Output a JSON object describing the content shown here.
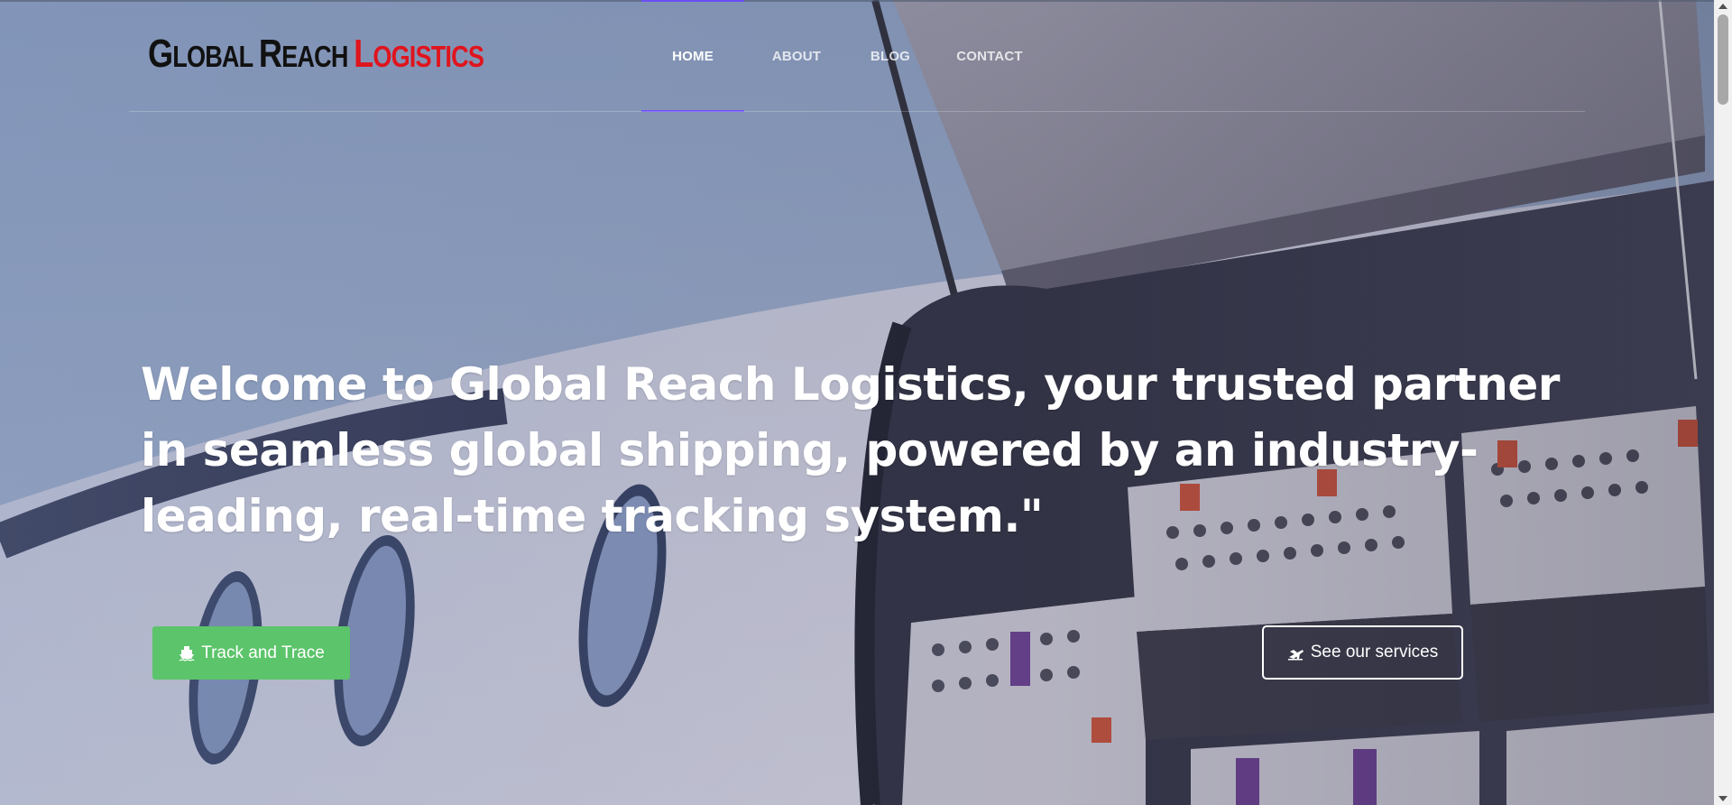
{
  "logo": {
    "words": [
      {
        "cap": "G",
        "rest": "LOBAL",
        "color": "dark"
      },
      {
        "cap": "R",
        "rest": "EACH",
        "color": "dark"
      },
      {
        "cap": "L",
        "rest": "OGISTICS",
        "color": "red"
      }
    ],
    "colors": {
      "dark": "#111111",
      "red": "#e0141d"
    }
  },
  "nav": {
    "items": [
      {
        "label": "HOME",
        "active": true
      },
      {
        "label": "ABOUT",
        "active": false
      },
      {
        "label": "BLOG",
        "active": false
      },
      {
        "label": "CONTACT",
        "active": false
      }
    ],
    "active_color": "#6b4ef5"
  },
  "hero": {
    "title": "Welcome to Global Reach Logistics, your trusted partner in seamless global shipping, powered by an industry-leading, real-time tracking system.\""
  },
  "buttons": {
    "track": {
      "label": "Track and Trace",
      "icon": "ship-icon",
      "color": "#5cc46a"
    },
    "services": {
      "label": "See our services",
      "icon": "plane-icon"
    }
  }
}
